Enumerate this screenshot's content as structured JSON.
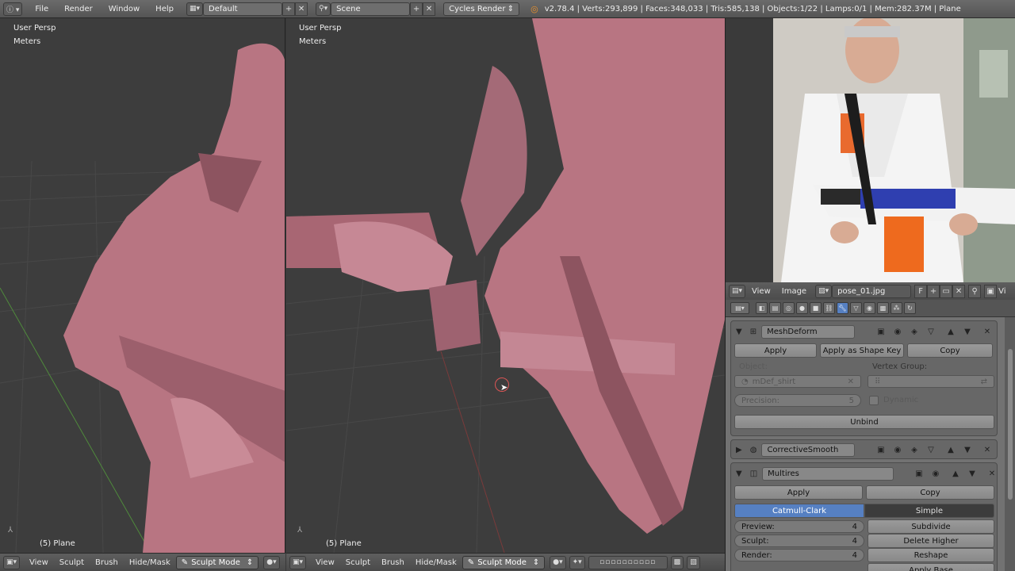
{
  "topbar": {
    "info_icon": "info-icon",
    "menus": [
      "File",
      "Render",
      "Window",
      "Help"
    ],
    "screen_layout": "Default",
    "scene": "Scene",
    "render_engine": "Cycles Render",
    "stats": "v2.78.4 | Verts:293,899 | Faces:348,033 | Tris:585,138 | Objects:1/22 | Lamps:0/1 | Mem:282.37M | Plane"
  },
  "viewport_left": {
    "view_label": "User Persp",
    "units_label": "Meters",
    "object_label": "(5) Plane"
  },
  "viewport_main": {
    "view_label": "User Persp",
    "units_label": "Meters",
    "object_label": "(5) Plane"
  },
  "bottombar_left": {
    "menus": [
      "View",
      "Sculpt",
      "Brush",
      "Hide/Mask"
    ],
    "mode": "Sculpt Mode"
  },
  "bottombar_main": {
    "menus": [
      "View",
      "Sculpt",
      "Brush",
      "Hide/Mask"
    ],
    "mode": "Sculpt Mode"
  },
  "image_editor": {
    "menus": [
      "View",
      "Image"
    ],
    "image_name": "pose_01.jpg",
    "fake_user": "F",
    "overflow_label": "Vi"
  },
  "modifiers": {
    "meshdeform": {
      "name": "MeshDeform",
      "apply": "Apply",
      "apply_shape": "Apply as Shape Key",
      "copy": "Copy",
      "object_label": "Object:",
      "object_value": "mDef_shirt",
      "vgroup_label": "Vertex Group:",
      "precision_label": "Precision:",
      "precision_value": "5",
      "dynamic_label": "Dynamic",
      "unbind": "Unbind"
    },
    "corrective": {
      "name": "CorrectiveSmooth"
    },
    "multires": {
      "name": "Multires",
      "apply": "Apply",
      "copy": "Copy",
      "catmull": "Catmull-Clark",
      "simple": "Simple",
      "preview_label": "Preview:",
      "preview_value": "4",
      "sculpt_label": "Sculpt:",
      "sculpt_value": "4",
      "render_label": "Render:",
      "render_value": "4",
      "subdivide": "Subdivide",
      "delete_higher": "Delete Higher",
      "reshape": "Reshape",
      "apply_base": "Apply Base"
    }
  },
  "colors": {
    "accent": "#5680c2",
    "mesh": "#b87582",
    "viewport_bg": "#3d3d3d",
    "panel_bg": "#727272"
  }
}
